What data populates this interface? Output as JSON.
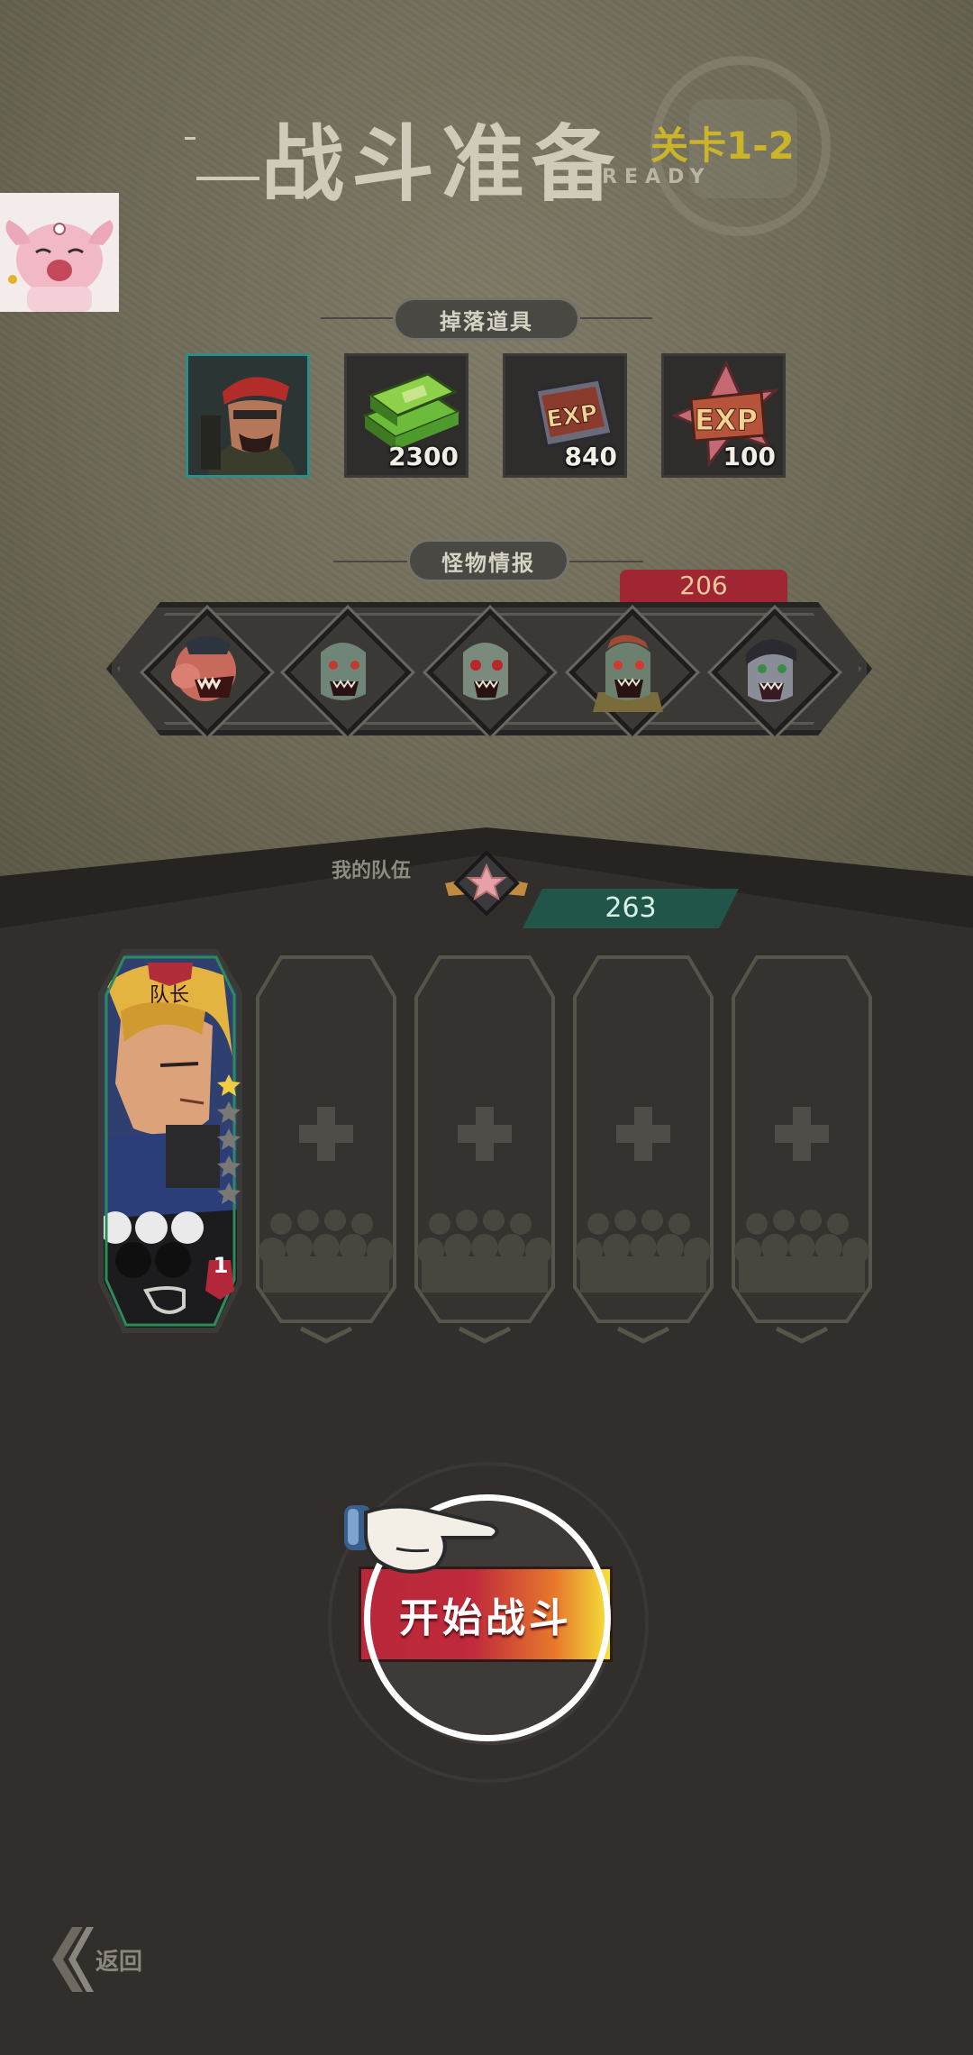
{
  "header": {
    "title": "战斗准备",
    "subtitle": "READY",
    "stage": "关卡1-2"
  },
  "drops": {
    "label": "掉落道具",
    "items": [
      {
        "icon": "hero-portrait-icon",
        "qty": ""
      },
      {
        "icon": "cash-stack-icon",
        "qty": "2300"
      },
      {
        "icon": "exp-book-icon",
        "qty": "840"
      },
      {
        "icon": "exp-star-icon",
        "qty": "100"
      }
    ]
  },
  "monsters": {
    "label": "怪物情报",
    "power": "206",
    "items": [
      {
        "icon": "zombie-pig-icon"
      },
      {
        "icon": "zombie-icon"
      },
      {
        "icon": "zombie-icon"
      },
      {
        "icon": "zombie-soldier-icon"
      },
      {
        "icon": "zombie-icon"
      }
    ]
  },
  "team": {
    "label": "我的队伍",
    "power": "263",
    "leader": {
      "tag": "队长",
      "level": "1",
      "stars_filled": 1,
      "stars_total": 5
    },
    "empty_slots": 4
  },
  "actions": {
    "start": "开始战斗",
    "back": "返回"
  },
  "colors": {
    "accent_red": "#b7283a",
    "accent_teal": "#2b8f87",
    "stage_gold": "#c9b42a"
  }
}
